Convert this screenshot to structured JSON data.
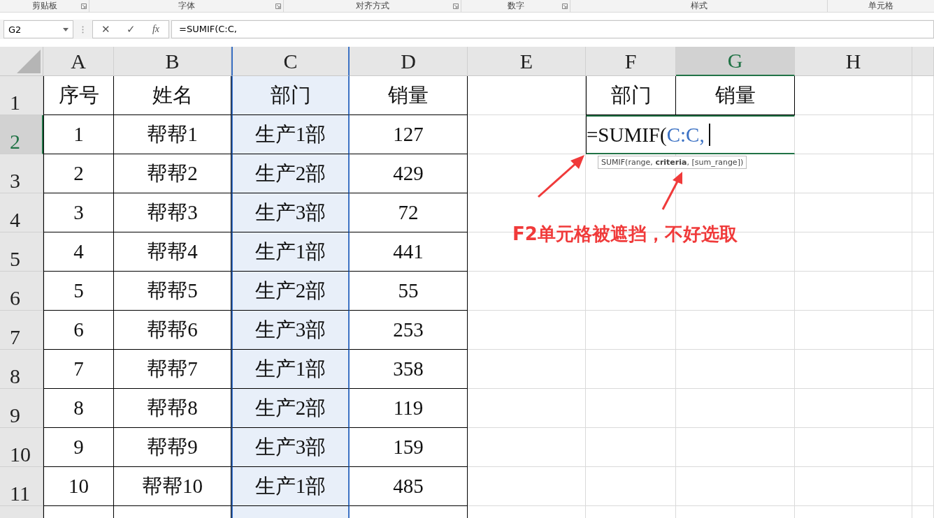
{
  "ribbon_groups": [
    {
      "label": "剪贴板",
      "launcher": true
    },
    {
      "label": "字体",
      "launcher": true
    },
    {
      "label": "对齐方式",
      "launcher": true
    },
    {
      "label": "数字",
      "launcher": true
    },
    {
      "label": "样式",
      "launcher": false
    },
    {
      "label": "单元格",
      "launcher": false
    }
  ],
  "formula_bar": {
    "name_box": "G2",
    "cancel": "✕",
    "enter": "✓",
    "fx": "fx",
    "formula": "=SUMIF(C:C,"
  },
  "columns": [
    {
      "label": "A",
      "selected": false,
      "referenced": false
    },
    {
      "label": "B",
      "selected": false,
      "referenced": false
    },
    {
      "label": "C",
      "selected": false,
      "referenced": true
    },
    {
      "label": "D",
      "selected": false,
      "referenced": false
    },
    {
      "label": "E",
      "selected": false,
      "referenced": false
    },
    {
      "label": "F",
      "selected": false,
      "referenced": false
    },
    {
      "label": "G",
      "selected": true,
      "referenced": false
    },
    {
      "label": "H",
      "selected": false,
      "referenced": false
    }
  ],
  "rows": [
    {
      "number": "1",
      "selected": false,
      "cells": [
        "序号",
        "姓名",
        "部门",
        "销量"
      ]
    },
    {
      "number": "2",
      "selected": true,
      "cells": [
        "1",
        "帮帮1",
        "生产1部",
        "127"
      ]
    },
    {
      "number": "3",
      "selected": false,
      "cells": [
        "2",
        "帮帮2",
        "生产2部",
        "429"
      ]
    },
    {
      "number": "4",
      "selected": false,
      "cells": [
        "3",
        "帮帮3",
        "生产3部",
        "72"
      ]
    },
    {
      "number": "5",
      "selected": false,
      "cells": [
        "4",
        "帮帮4",
        "生产1部",
        "441"
      ]
    },
    {
      "number": "6",
      "selected": false,
      "cells": [
        "5",
        "帮帮5",
        "生产2部",
        "55"
      ]
    },
    {
      "number": "7",
      "selected": false,
      "cells": [
        "6",
        "帮帮6",
        "生产3部",
        "253"
      ]
    },
    {
      "number": "8",
      "selected": false,
      "cells": [
        "7",
        "帮帮7",
        "生产1部",
        "358"
      ]
    },
    {
      "number": "9",
      "selected": false,
      "cells": [
        "8",
        "帮帮8",
        "生产2部",
        "119"
      ]
    },
    {
      "number": "10",
      "selected": false,
      "cells": [
        "9",
        "帮帮9",
        "生产3部",
        "159"
      ]
    },
    {
      "number": "11",
      "selected": false,
      "cells": [
        "10",
        "帮帮10",
        "生产1部",
        "485"
      ]
    }
  ],
  "lookup_headers": [
    "部门",
    "销量"
  ],
  "cell_editor": {
    "parts": [
      {
        "text": "=SUMIF(",
        "kind": "plain"
      },
      {
        "text": "C:C,",
        "kind": "ref"
      }
    ],
    "tooltip": "SUMIF(range, **criteria**, [sum_range])"
  },
  "annotation": {
    "text": "F2单元格被遮挡，不好选取"
  }
}
